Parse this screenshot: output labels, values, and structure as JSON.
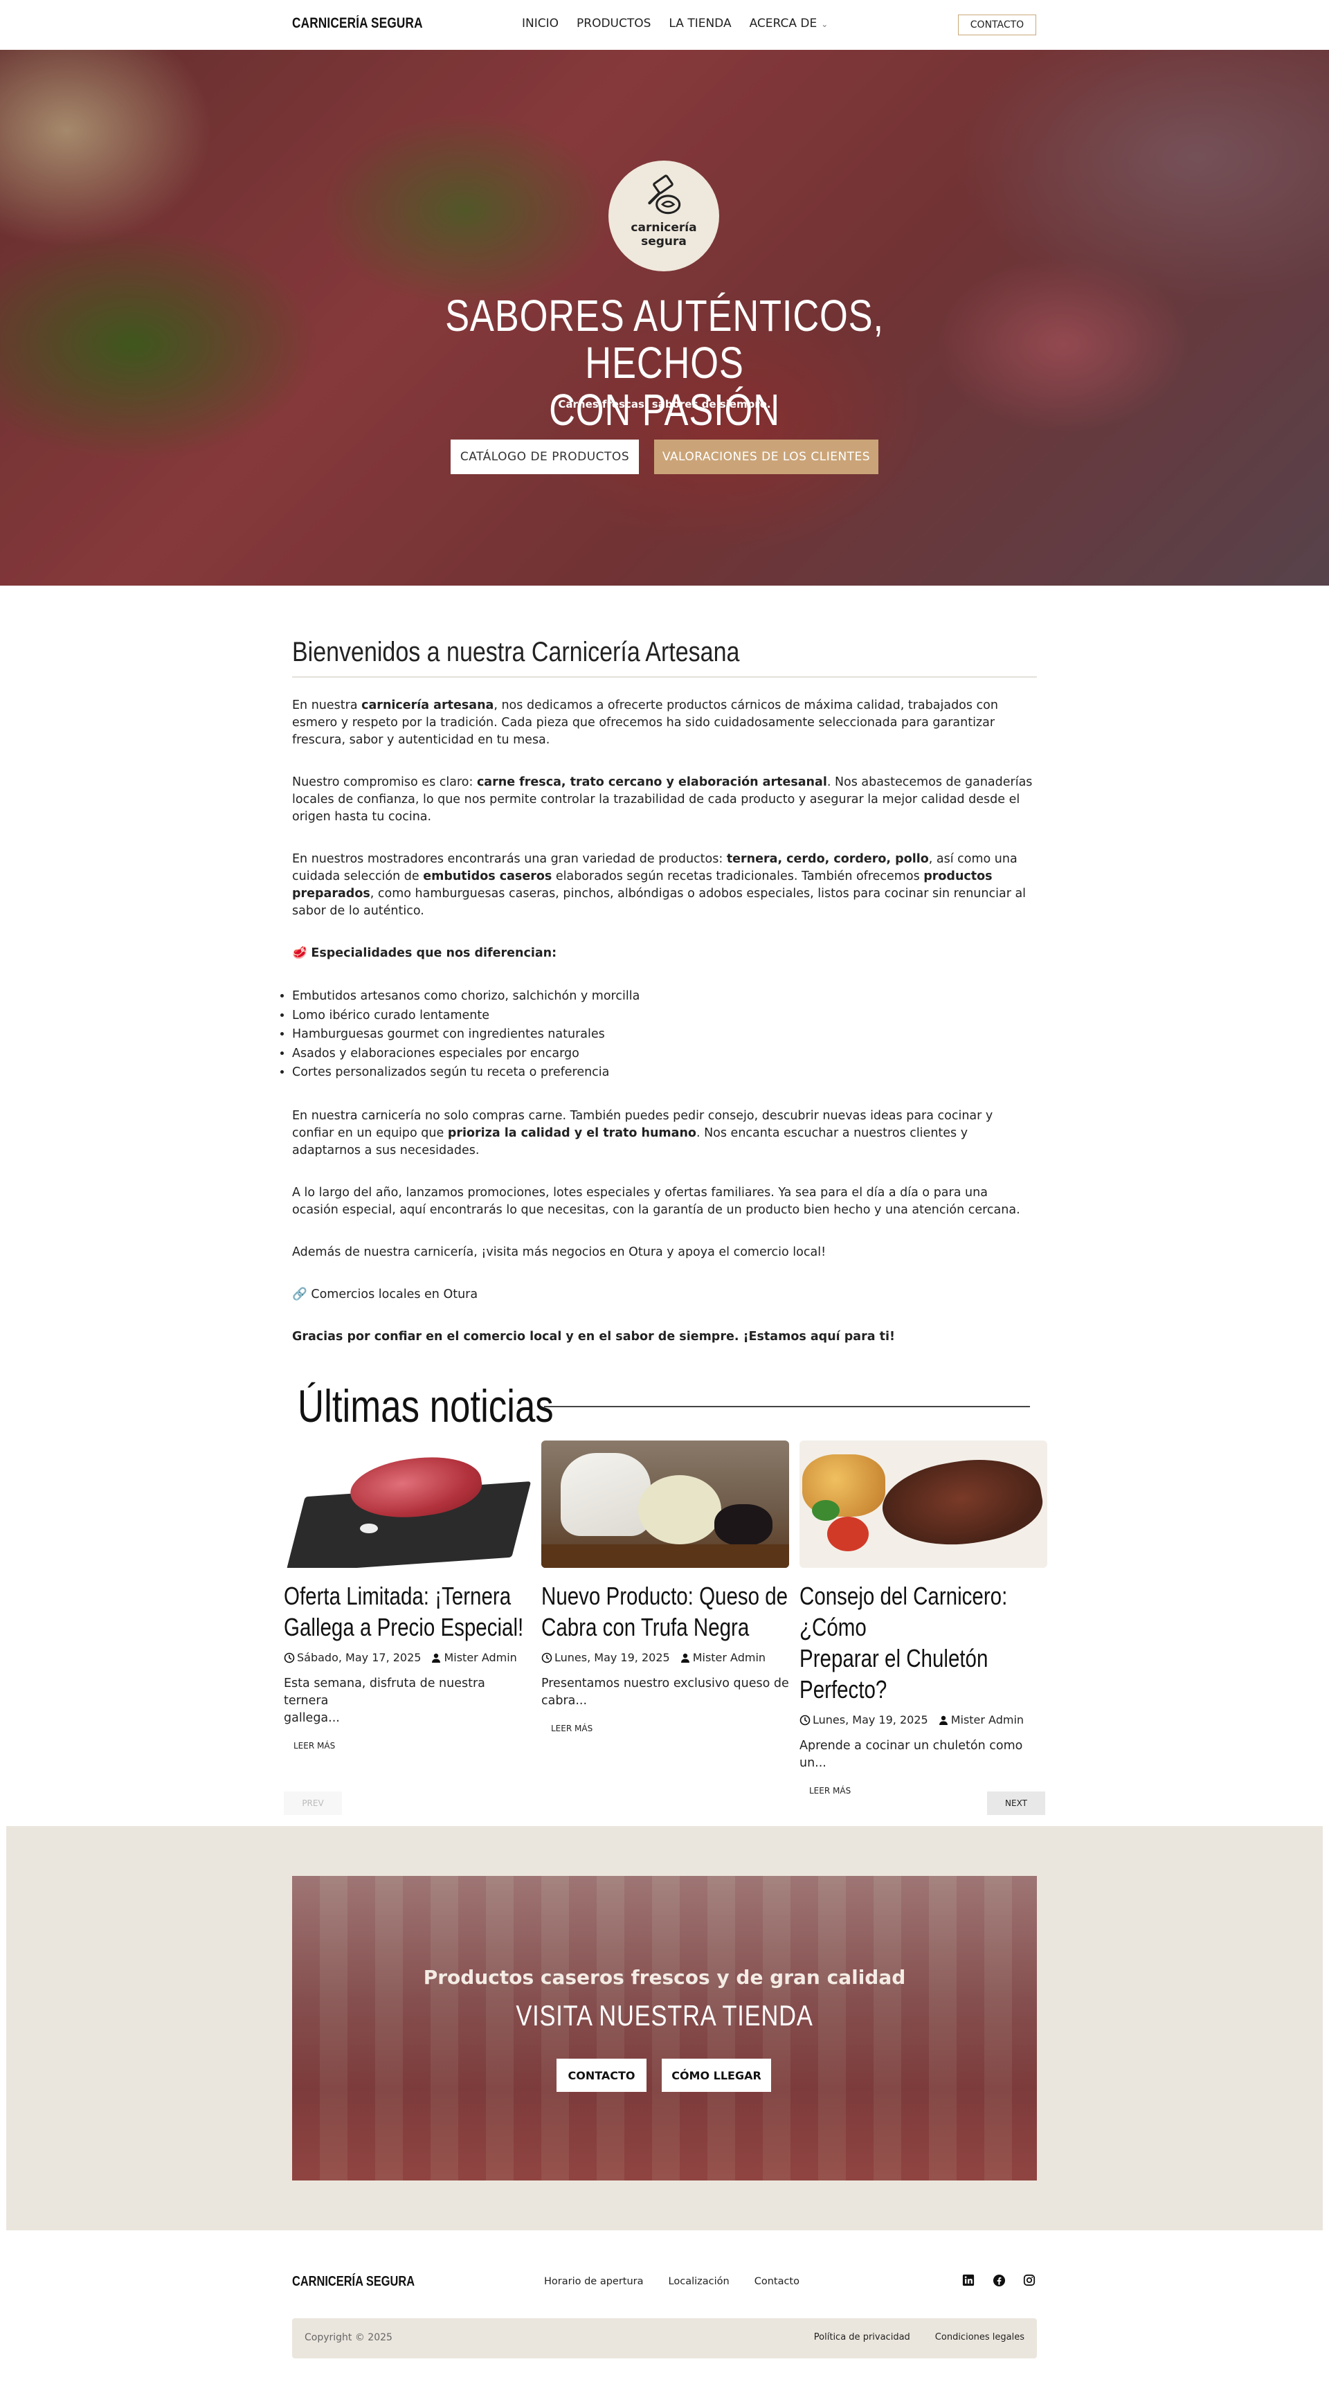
{
  "header": {
    "brand": "CARNICERÍA SEGURA",
    "nav": [
      "INICIO",
      "PRODUCTOS",
      "LA TIENDA",
      "ACERCA DE"
    ],
    "contact_button": "CONTACTO"
  },
  "hero": {
    "logo_line1": "carnicería",
    "logo_line2": "segura",
    "title_line1": "SABORES AUTÉNTICOS, HECHOS",
    "title_line2": "CON PASIÓN",
    "subtitle": "Carnes frescas, sabores de siempre.",
    "button_catalog": "CATÁLOGO DE PRODUCTOS",
    "button_reviews": "VALORACIONES DE LOS CLIENTES"
  },
  "welcome": {
    "title": "Bienvenidos a nuestra Carnicería Artesana",
    "p1_a": "En nuestra ",
    "p1_b": "carnicería artesana",
    "p1_c": ", nos dedicamos a ofrecerte productos cárnicos de máxima calidad, trabajados con esmero y respeto por la tradición. Cada pieza que ofrecemos ha sido cuidadosamente seleccionada para garantizar frescura, sabor y autenticidad en tu mesa.",
    "p2_a": "Nuestro compromiso es claro: ",
    "p2_b": "carne fresca, trato cercano y elaboración artesanal",
    "p2_c": ". Nos abastecemos de ganaderías locales de confianza, lo que nos permite controlar la trazabilidad de cada producto y asegurar la mejor calidad desde el origen hasta tu cocina.",
    "p3_a": "En nuestros mostradores encontrarás una gran variedad de productos: ",
    "p3_b": "ternera, cerdo, cordero, pollo",
    "p3_c": ", así como una cuidada selección de ",
    "p3_d": "embutidos caseros",
    "p3_e": " elaborados según recetas tradicionales. También ofrecemos ",
    "p3_f": "productos preparados",
    "p3_g": ", como hamburguesas caseras, pinchos, albóndigas o adobos especiales, listos para cocinar sin renunciar al sabor de lo auténtico.",
    "specialties_icon": "🥩",
    "specialties_title": "Especialidades que nos diferencian:",
    "specialties": [
      "Embutidos artesanos como chorizo, salchichón y morcilla",
      "Lomo ibérico curado lentamente",
      "Hamburguesas gourmet con ingredientes naturales",
      "Asados y elaboraciones especiales por encargo",
      "Cortes personalizados según tu receta o preferencia"
    ],
    "p4_a": "En nuestra carnicería no solo compras carne. También puedes pedir consejo, descubrir nuevas ideas para cocinar y confiar en un equipo que ",
    "p4_b": "prioriza la calidad y el trato humano",
    "p4_c": ". Nos encanta escuchar a nuestros clientes y adaptarnos a sus necesidades.",
    "p5": "A lo largo del año, lanzamos promociones, lotes especiales y ofertas familiares. Ya sea para el día a día o para una ocasión especial, aquí encontrarás lo que necesitas, con la garantía de un producto bien hecho y una atención cercana.",
    "p6": "Además de nuestra carnicería, ¡visita más negocios en Otura y apoya el comercio local!",
    "link_icon": "🔗",
    "link_text": "Comercios locales en Otura",
    "closing": "Gracias por confiar en el comercio local y en el sabor de siempre. ¡Estamos aquí para ti!"
  },
  "news": {
    "title": "Últimas noticias",
    "posts": [
      {
        "title_line1": "Oferta Limitada: ¡Ternera",
        "title_line2": "Gallega a Precio Especial!",
        "date": "Sábado, May 17, 2025",
        "author": "Mister Admin",
        "excerpt_line1": "Esta semana, disfruta de nuestra ternera",
        "excerpt_line2": "gallega...",
        "read_more": "LEER MÁS",
        "image": "beef-on-slate"
      },
      {
        "title_line1": "Nuevo Producto: Queso de",
        "title_line2": "Cabra con Trufa Negra",
        "date": "Lunes, May 19, 2025",
        "author": "Mister Admin",
        "excerpt_line1": "Presentamos nuestro exclusivo queso de",
        "excerpt_line2": "cabra...",
        "read_more": "LEER MÁS",
        "image": "goat-cheese-truffle"
      },
      {
        "title_line1": "Consejo del Carnicero: ¿Cómo",
        "title_line2": "Preparar el Chuletón",
        "title_line3": "Perfecto?",
        "date": "Lunes, May 19, 2025",
        "author": "Mister Admin",
        "excerpt_line1": "Aprende a cocinar un chuletón como un...",
        "read_more": "LEER MÁS",
        "image": "grilled-steak"
      }
    ],
    "prev": "PREV",
    "next": "NEXT"
  },
  "cta": {
    "subtitle": "Productos caseros frescos y de gran calidad",
    "title": "VISITA NUESTRA TIENDA",
    "button_contact": "CONTACTO",
    "button_directions": "CÓMO LLEGAR"
  },
  "footer": {
    "brand": "CARNICERÍA SEGURA",
    "links": [
      "Horario de apertura",
      "Localización",
      "Contacto"
    ],
    "socials": [
      "linkedin-icon",
      "facebook-icon",
      "instagram-icon"
    ],
    "copyright": "Copyright © 2025",
    "legal": [
      "Política de privacidad",
      "Condiciones legales"
    ]
  }
}
